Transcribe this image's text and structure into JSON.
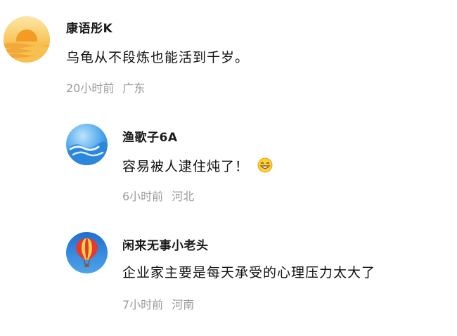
{
  "comments": [
    {
      "username": "康语彤K",
      "text": "乌龟从不段炼也能活到千岁。",
      "time": "20小时前",
      "location": "广东",
      "avatar_icon": "sunset-avatar-icon"
    },
    {
      "username": "渔歌子6A",
      "text": "容易被人逮住炖了！",
      "time": "6小时前",
      "location": "河北",
      "avatar_icon": "sea-wave-avatar-icon",
      "emoji_icon": "grin-emoji-icon"
    },
    {
      "username": "闲来无事小老头",
      "text": "企业家主要是每天承受的心理压力太大了",
      "time": "7小时前",
      "location": "河南",
      "avatar_icon": "hot-air-balloon-avatar-icon"
    }
  ],
  "colors": {
    "username": "#1a1a1a",
    "text": "#111111",
    "meta": "#9a9a9a",
    "sunset": "#f4b43a",
    "sea": "#3a8fd8",
    "sky": "#2f7fd6"
  }
}
